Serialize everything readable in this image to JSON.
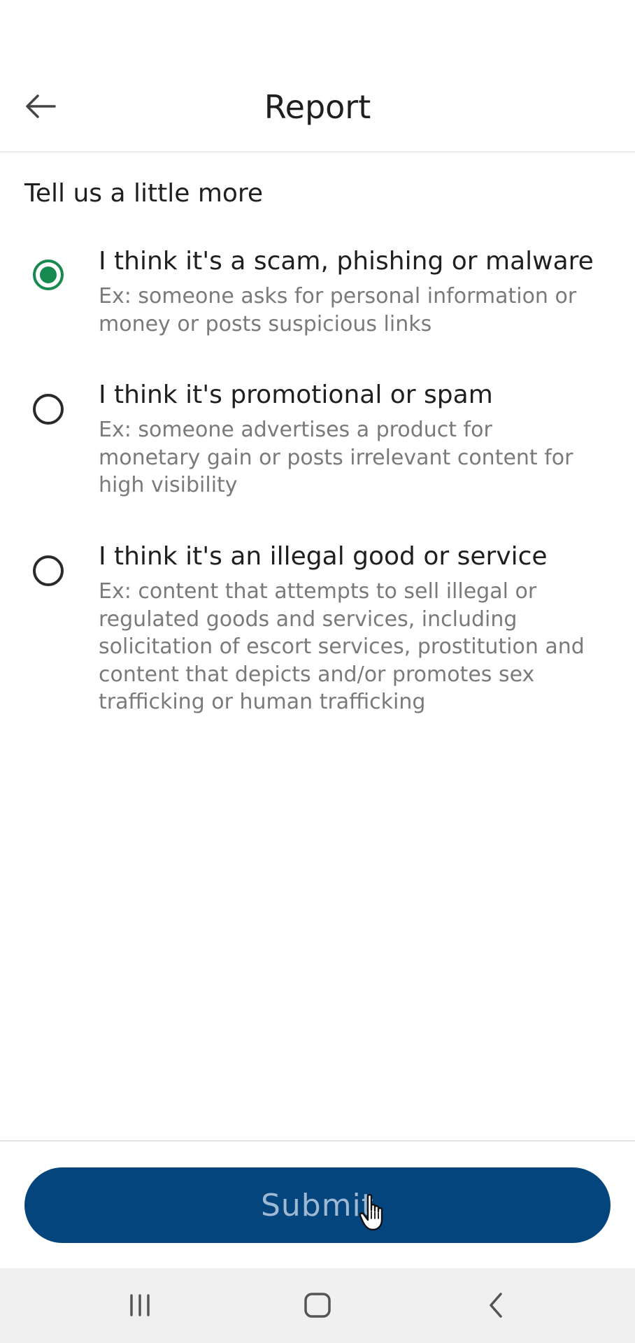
{
  "header": {
    "title": "Report",
    "back_icon": "arrow-left-icon"
  },
  "subtitle": "Tell us a little more",
  "options": [
    {
      "title": "I think it's a scam, phishing or malware",
      "description": "Ex: someone asks for personal information or money or posts suspicious links",
      "selected": true
    },
    {
      "title": "I think it's promotional or spam",
      "description": "Ex: someone advertises a product for monetary gain or posts irrelevant content for high visibility",
      "selected": false
    },
    {
      "title": "I think it's an illegal good or service",
      "description": "Ex: content that attempts to sell illegal or regulated goods and services, including solicitation of escort services, prostitution and content that depicts and/or promotes sex trafficking or human trafficking",
      "selected": false
    }
  ],
  "submit": {
    "label": "Submit"
  },
  "navbar": {
    "recents_icon": "recents-icon",
    "home_icon": "home-icon",
    "back_icon": "back-chevron-icon"
  },
  "colors": {
    "accent": "#168a4f",
    "primary_button": "#05457e",
    "button_text_disabled": "#9fb9d2"
  }
}
